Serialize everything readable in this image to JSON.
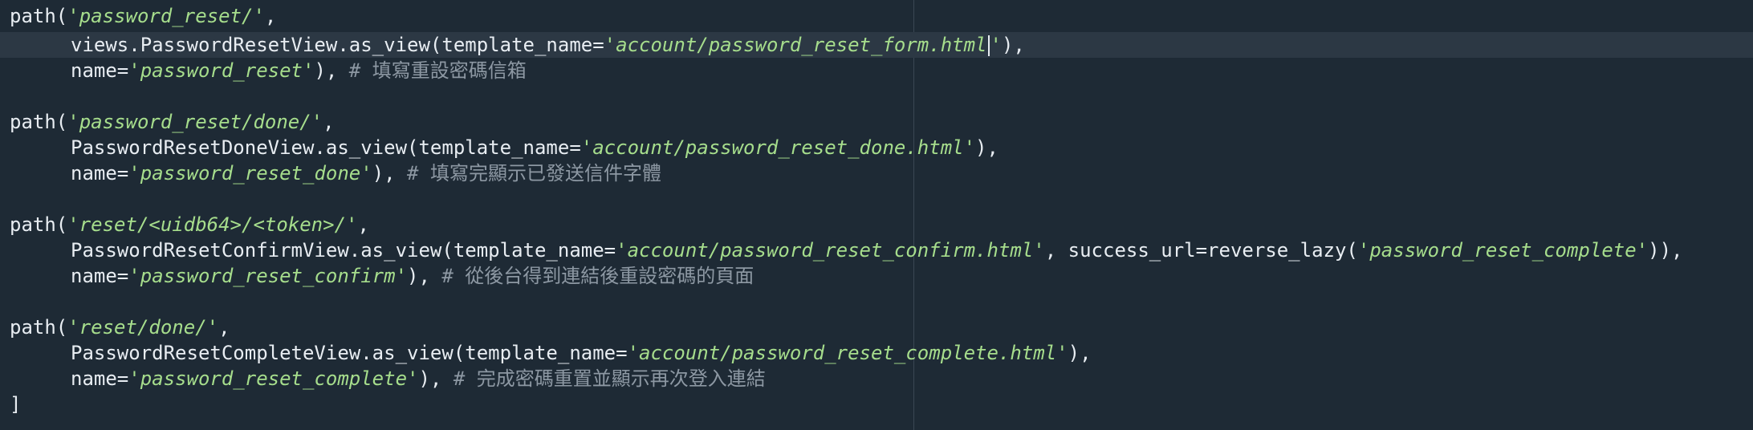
{
  "editor": {
    "blocks": [
      {
        "path_fn": "path(",
        "route": "'password_reset/'",
        "route_tail": ",",
        "view_prefix": "views.PasswordResetView.as_view(template_name=",
        "template_a": "'account/password_reset_form.html",
        "template_b": "'",
        "view_suffix": "),",
        "name_prefix": "name=",
        "name_value": "'password_reset'",
        "name_suffix": "), ",
        "comment": "# 填寫重設密碼信箱"
      },
      {
        "path_fn": "path(",
        "route": "'password_reset/done/'",
        "route_tail": ",",
        "view_prefix": "PasswordResetDoneView.as_view(template_name=",
        "template": "'account/password_reset_done.html'",
        "view_suffix": "),",
        "name_prefix": "name=",
        "name_value": "'password_reset_done'",
        "name_suffix": "), ",
        "comment": "# 填寫完顯示已發送信件字體"
      },
      {
        "path_fn": "path(",
        "route": "'reset/<uidb64>/<token>/'",
        "route_tail": ",",
        "view_prefix": "PasswordResetConfirmView.as_view(template_name=",
        "template": "'account/password_reset_confirm.html'",
        "mid": ", success_url=reverse_lazy(",
        "success_name": "'password_reset_complete'",
        "view_suffix": ")),",
        "name_prefix": "name=",
        "name_value": "'password_reset_confirm'",
        "name_suffix": "), ",
        "comment": "# 從後台得到連結後重設密碼的頁面"
      },
      {
        "path_fn": "path(",
        "route": "'reset/done/'",
        "route_tail": ",",
        "view_prefix": "PasswordResetCompleteView.as_view(template_name=",
        "template": "'account/password_reset_complete.html'",
        "view_suffix": "),",
        "name_prefix": "name=",
        "name_value": "'password_reset_complete'",
        "name_suffix": "), ",
        "comment": "# 完成密碼重置並顯示再次登入連結"
      }
    ],
    "closing": "]",
    "colors": {
      "background": "#1e2a35",
      "active_line": "#2c3844",
      "text": "#e8edf2",
      "string": "#a6dd8c",
      "comment": "#8d98a3"
    }
  }
}
